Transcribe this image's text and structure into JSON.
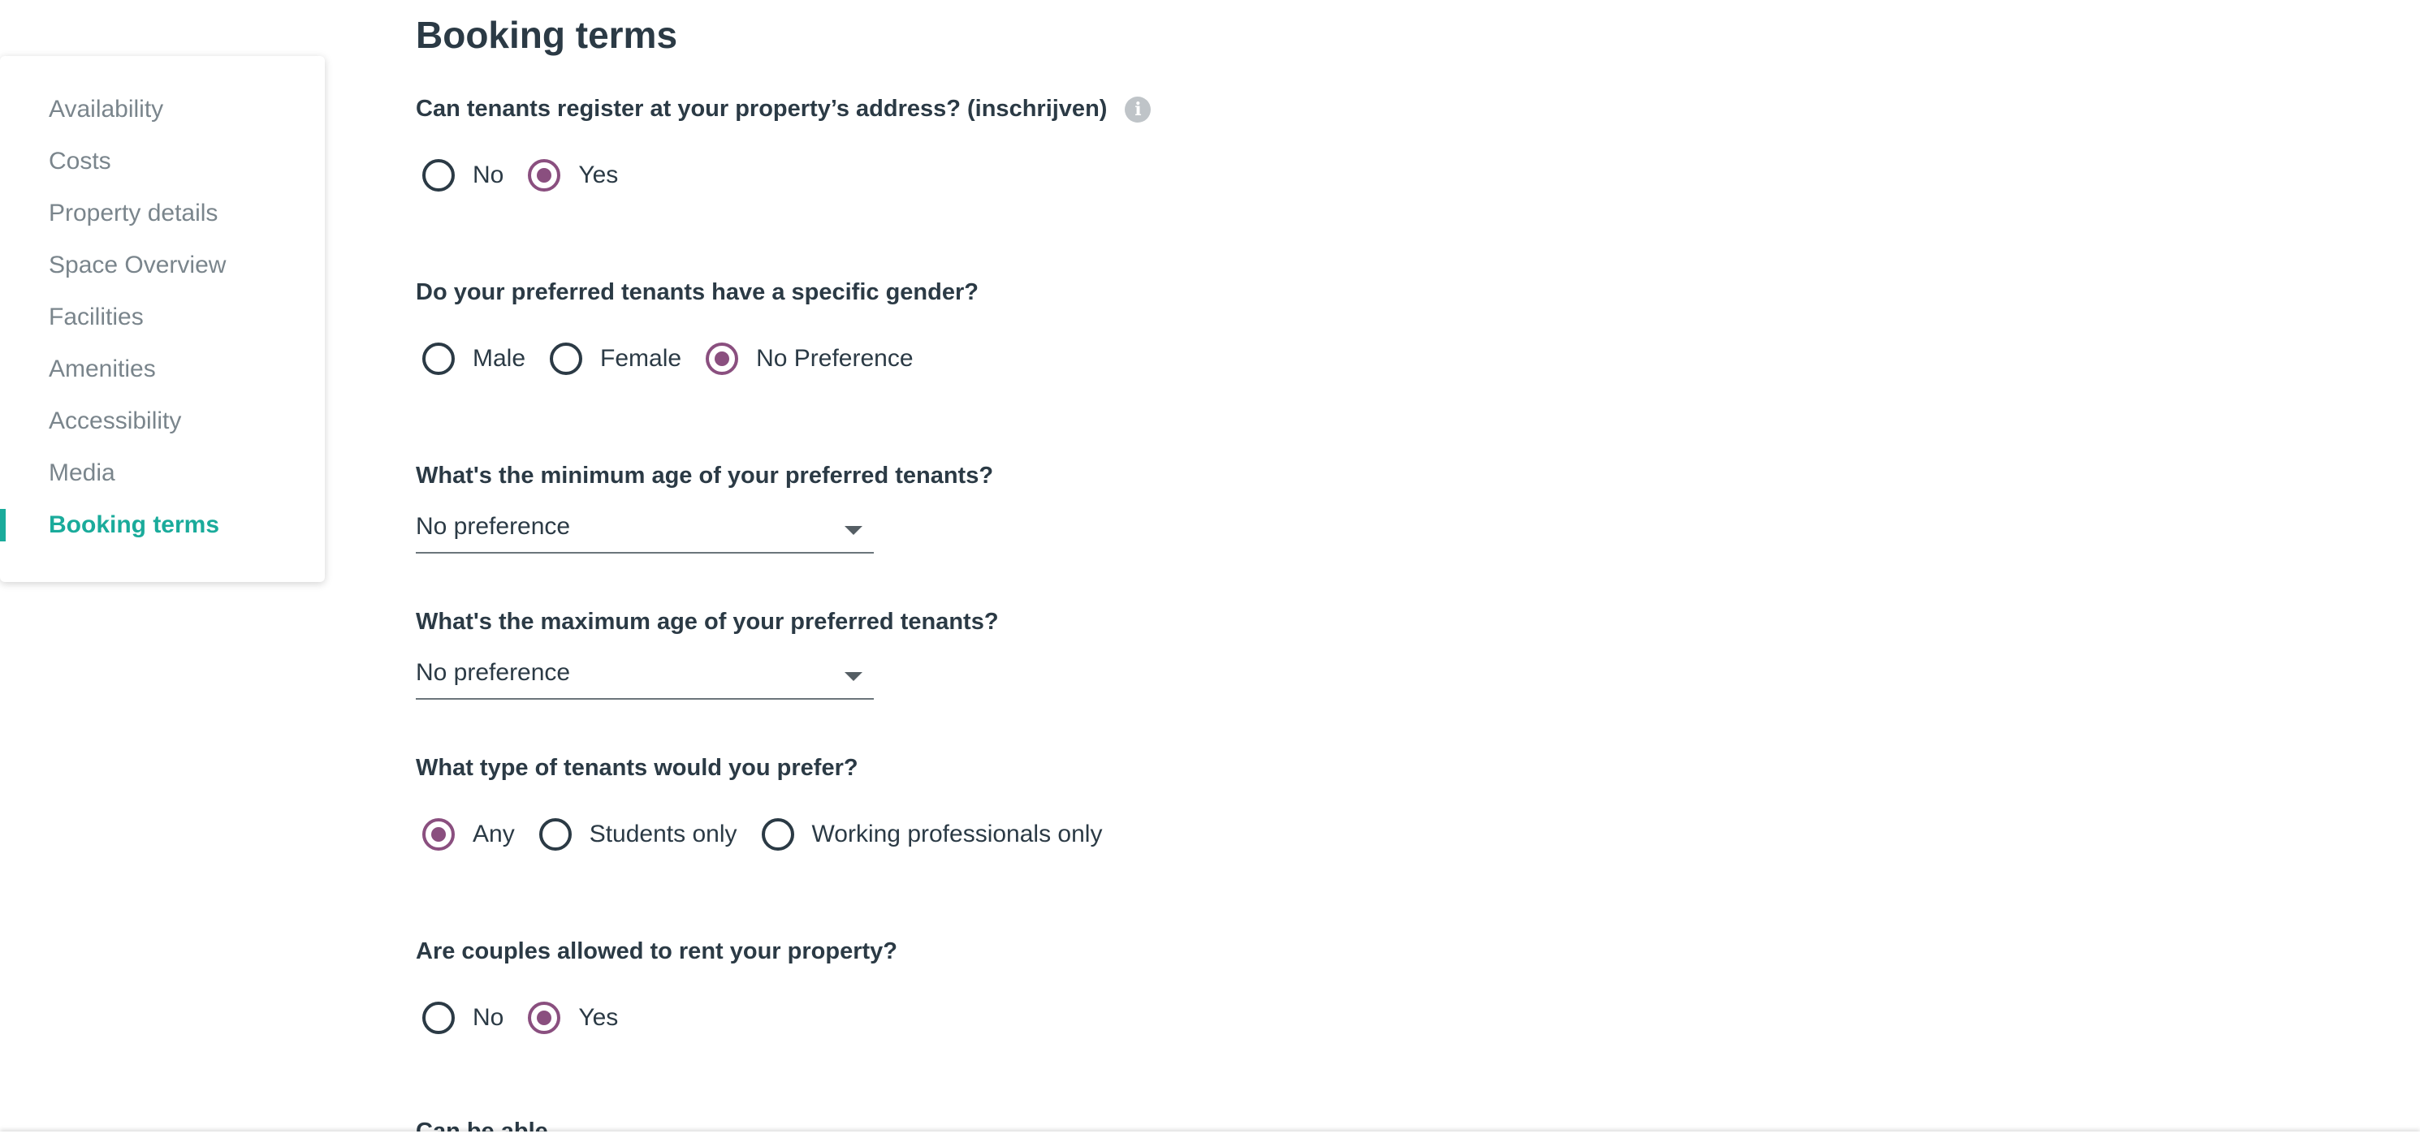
{
  "sidebar": {
    "items": [
      {
        "label": "Availability"
      },
      {
        "label": "Costs"
      },
      {
        "label": "Property details"
      },
      {
        "label": "Space Overview"
      },
      {
        "label": "Facilities"
      },
      {
        "label": "Amenities"
      },
      {
        "label": "Accessibility"
      },
      {
        "label": "Media"
      },
      {
        "label": "Booking terms",
        "active": true
      }
    ]
  },
  "main": {
    "title": "Booking terms",
    "register": {
      "question": "Can tenants register at your property’s address? (inschrijven)",
      "icon": "info-icon",
      "options": [
        "No",
        "Yes"
      ],
      "selected": "Yes"
    },
    "gender": {
      "question": "Do your preferred tenants have a specific gender?",
      "options": [
        "Male",
        "Female",
        "No Preference"
      ],
      "selected": "No Preference"
    },
    "min_age": {
      "question": "What's the minimum age of your preferred tenants?",
      "value": "No preference"
    },
    "max_age": {
      "question": "What's the maximum age of your preferred tenants?",
      "value": "No preference"
    },
    "tenant_type": {
      "question": "What type of tenants would you prefer?",
      "options": [
        "Any",
        "Students only",
        "Working professionals only"
      ],
      "selected": "Any"
    },
    "couples": {
      "question": "Are couples allowed to rent your property?",
      "options": [
        "No",
        "Yes"
      ],
      "selected": "Yes"
    },
    "next_heading_partial": "Can be able"
  },
  "colors": {
    "accent": "#1aab9b",
    "radio_checked": "#8a4f7f",
    "text": "#2b3a45",
    "sidebar_text": "#7a858c"
  }
}
